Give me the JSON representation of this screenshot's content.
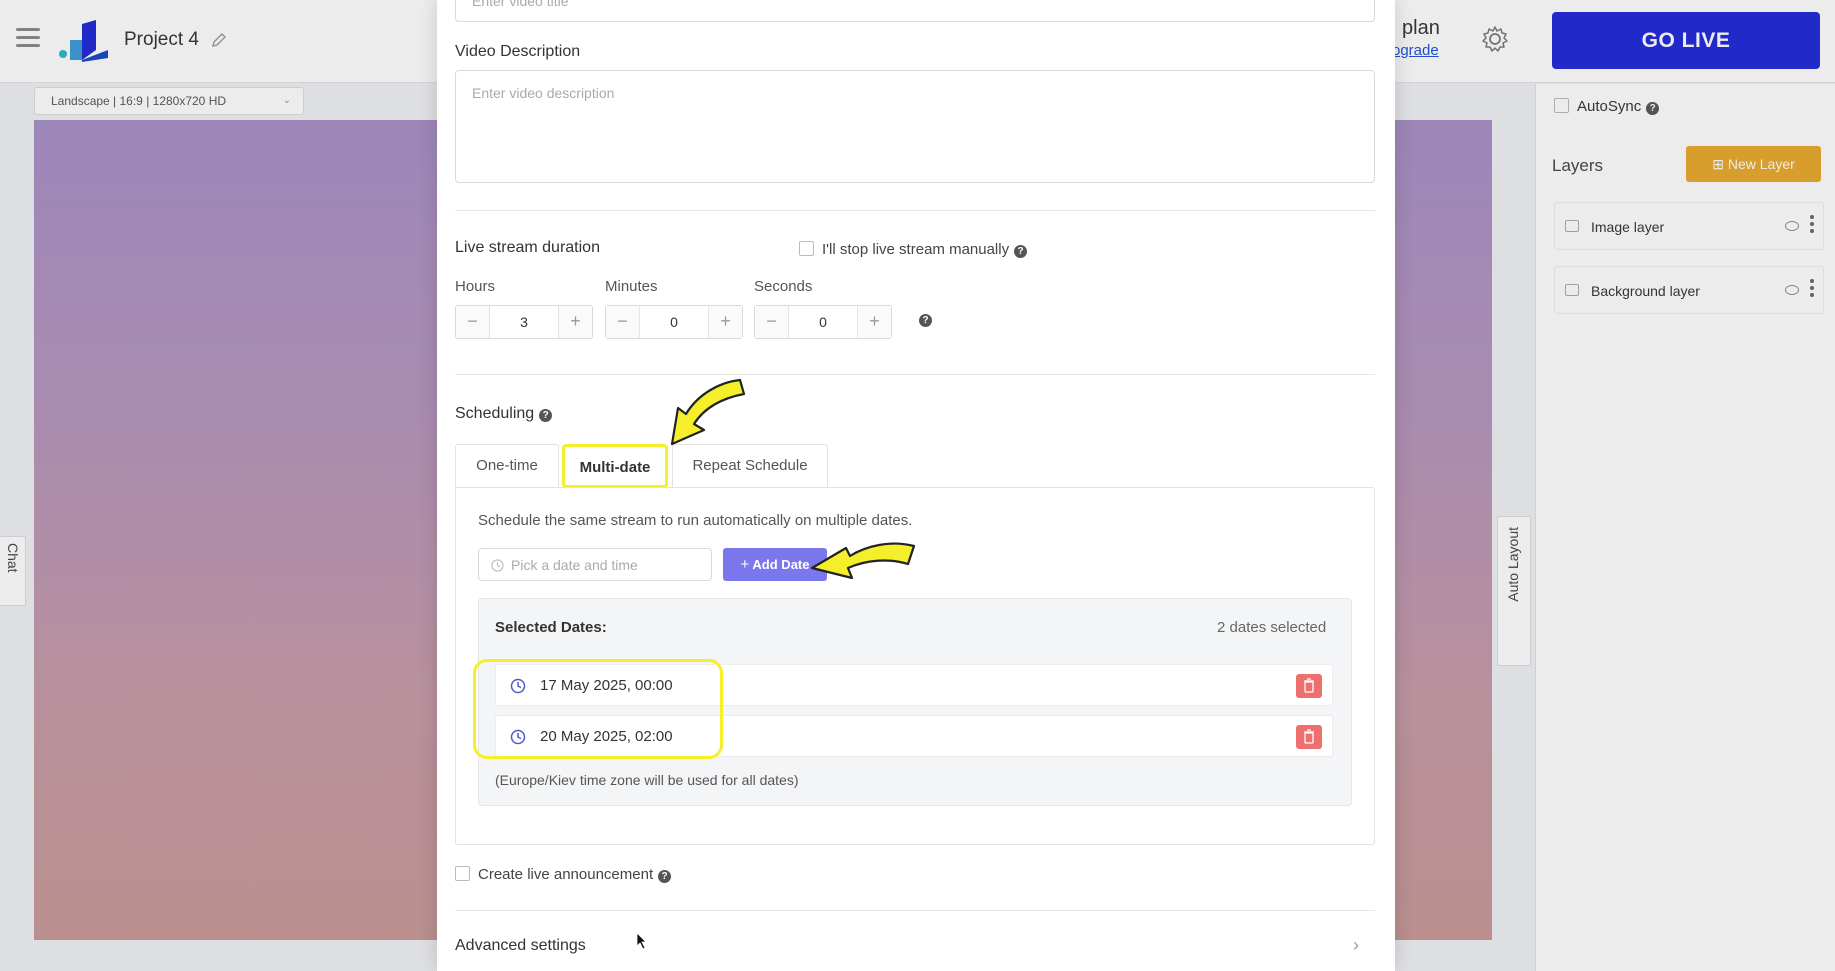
{
  "app": {
    "project_title": "Project 4",
    "plan_text": "plan",
    "upgrade_text": "ograde",
    "go_live": "GO LIVE",
    "resolution": "Landscape | 16:9 | 1280x720 HD",
    "chat_tab": "Chat",
    "auto_layout_tab": "Auto Layout"
  },
  "right_panel": {
    "autosync": "AutoSync",
    "layers_title": "Layers",
    "new_layer": "New Layer",
    "layers": [
      {
        "label": "Image layer"
      },
      {
        "label": "Background layer"
      }
    ]
  },
  "modal": {
    "title_placeholder": "Enter video title",
    "description_label": "Video Description",
    "description_placeholder": "Enter video description",
    "duration_label": "Live stream duration",
    "manual_stop_label": "I'll stop live stream manually",
    "hours_label": "Hours",
    "minutes_label": "Minutes",
    "seconds_label": "Seconds",
    "hours_value": "3",
    "minutes_value": "0",
    "seconds_value": "0",
    "scheduling_label": "Scheduling",
    "tabs": [
      {
        "label": "One-time"
      },
      {
        "label": "Multi-date"
      },
      {
        "label": "Repeat Schedule"
      }
    ],
    "multi_date_hint": "Schedule the same stream to run automatically on multiple dates.",
    "date_picker_placeholder": "Pick a date and time",
    "add_date_button": "Add Date",
    "selected_dates_label": "Selected Dates:",
    "dates_count": "2 dates selected",
    "dates": [
      {
        "text": "17 May 2025, 00:00"
      },
      {
        "text": "20 May 2025, 02:00"
      }
    ],
    "timezone_note": "(Europe/Kiev time zone will be used for all dates)",
    "announcement_label": "Create live announcement",
    "advanced_settings": "Advanced settings"
  },
  "colors": {
    "go_live_bg": "#1d27d6",
    "new_layer_bg": "#e8a92a",
    "add_date_bg": "#7b78ee",
    "trash_bg": "#ef6f6f",
    "annotation_yellow": "#f5ee2a"
  },
  "icons": [
    "hamburger-icon",
    "logo-icon",
    "pencil-icon",
    "gear-icon",
    "help-icon",
    "clock-icon",
    "trash-icon",
    "eye-icon",
    "chevron-right-icon",
    "arrow-annotation"
  ]
}
